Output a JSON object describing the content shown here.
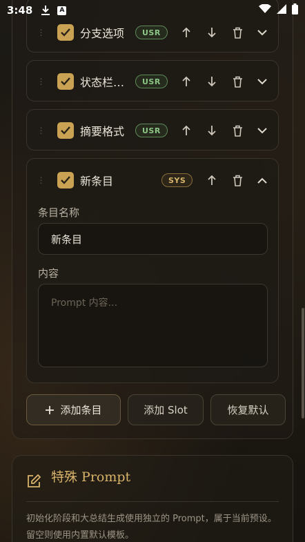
{
  "status_bar": {
    "time": "3:48",
    "download_icon": "download-icon",
    "a_icon_text": "A",
    "wifi_icon": "wifi-icon",
    "signal_icon": "signal-icon",
    "battery_icon": "battery-icon"
  },
  "entries": [
    {
      "title": "分支选项",
      "badge": "USR",
      "checked": true,
      "expanded": false
    },
    {
      "title": "状态栏…",
      "badge": "USR",
      "checked": true,
      "expanded": false
    },
    {
      "title": "摘要格式",
      "badge": "USR",
      "checked": true,
      "expanded": false
    },
    {
      "title": "新条目",
      "badge": "SYS",
      "checked": true,
      "expanded": true
    }
  ],
  "editor": {
    "name_label": "条目名称",
    "name_value": "新条目",
    "content_label": "内容",
    "content_placeholder": "Prompt 内容..."
  },
  "actions": {
    "add_entry": "添加条目",
    "add_slot": "添加 Slot",
    "restore_default": "恢复默认"
  },
  "special_prompt": {
    "title": "特殊 Prompt",
    "description": "初始化阶段和大总结生成使用独立的 Prompt，属于当前预设。留空则使用内置默认模板。"
  },
  "colors": {
    "accent": "#c9a253",
    "usr_badge": "#8cc585",
    "sys_badge": "#d7b56a",
    "background": "#1b1813"
  }
}
